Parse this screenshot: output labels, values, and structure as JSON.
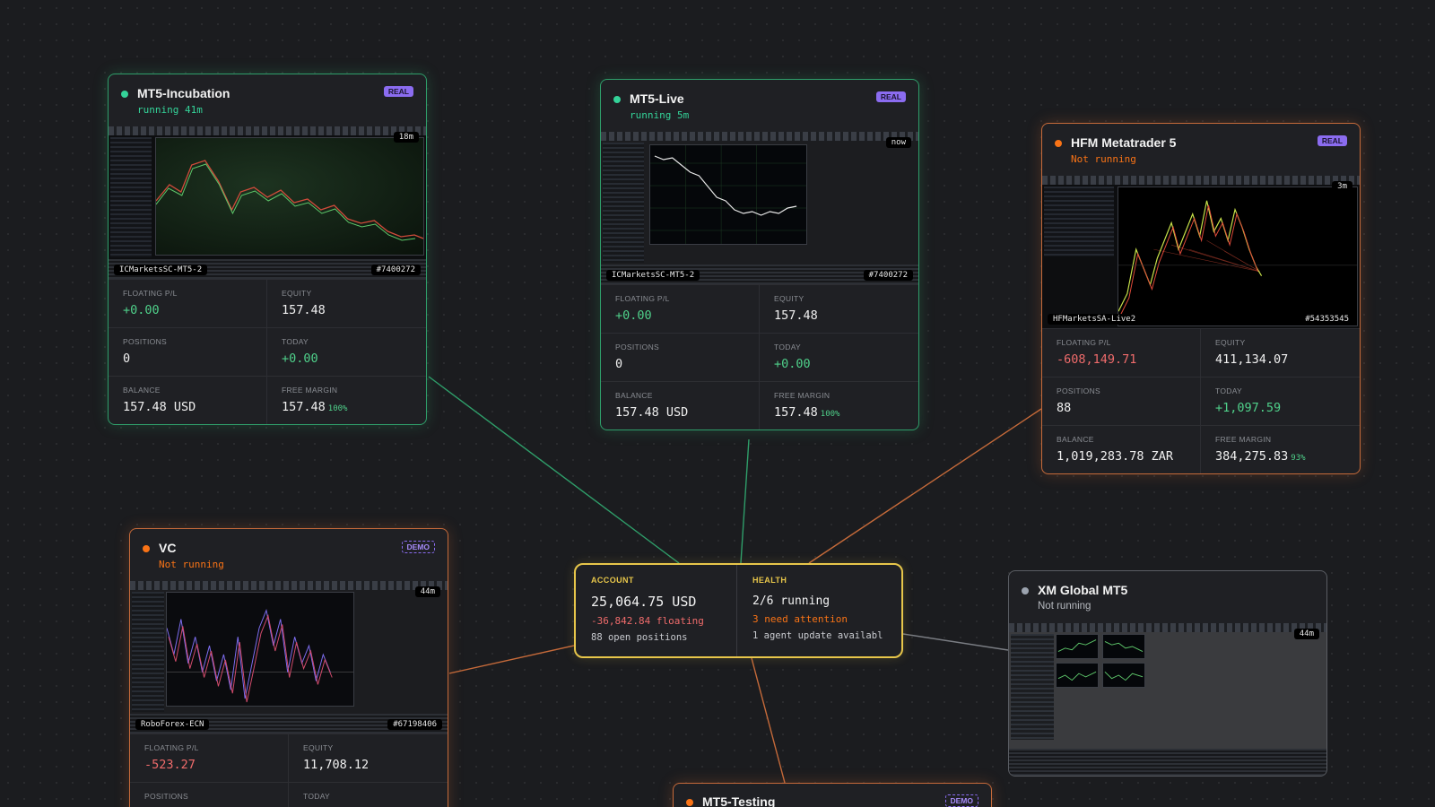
{
  "colors": {
    "running": "#34d399",
    "not_running": "#f97316",
    "offline": "#9ca3af",
    "positive": "#4fd08a",
    "negative": "#ef6b6b",
    "badge": "#8b6cf0",
    "summary_accent": "#e7c64a"
  },
  "labels": {
    "floating": "FLOATING P/L",
    "equity": "EQUITY",
    "positions": "POSITIONS",
    "today": "TODAY",
    "balance": "BALANCE",
    "free_margin": "FREE MARGIN"
  },
  "terminals": [
    {
      "name": "MT5-Incubation",
      "status": "running 41m",
      "badge": "REAL",
      "age": "18m",
      "server": "ICMarketsSC-MT5-2",
      "account": "#7400272",
      "floating": "+0.00",
      "equity": "157.48",
      "positions": "0",
      "today": "+0.00",
      "balance": "157.48 USD",
      "free_margin": "157.48",
      "free_margin_pct": "100%"
    },
    {
      "name": "MT5-Live",
      "status": "running 5m",
      "badge": "REAL",
      "age": "now",
      "server": "ICMarketsSC-MT5-2",
      "account": "#7400272",
      "floating": "+0.00",
      "equity": "157.48",
      "positions": "0",
      "today": "+0.00",
      "balance": "157.48 USD",
      "free_margin": "157.48",
      "free_margin_pct": "100%"
    },
    {
      "name": "HFM Metatrader 5",
      "status": "Not running",
      "badge": "REAL",
      "age": "3m",
      "server": "HFMarketsSA-Live2",
      "account": "#54353545",
      "floating": "-608,149.71",
      "equity": "411,134.07",
      "positions": "88",
      "today": "+1,097.59",
      "balance": "1,019,283.78 ZAR",
      "free_margin": "384,275.83",
      "free_margin_pct": "93%"
    },
    {
      "name": "VC",
      "status": "Not running",
      "badge": "DEMO",
      "age": "44m",
      "server": "RoboForex-ECN",
      "account": "#67198406",
      "floating": "-523.27",
      "equity": "11,708.12"
    },
    {
      "name": "XM Global MT5",
      "status": "Not running",
      "age": "44m"
    },
    {
      "name": "MT5-Testing",
      "badge": "DEMO"
    }
  ],
  "summary": {
    "account_label": "ACCOUNT",
    "total": "25,064.75 USD",
    "floating": "-36,842.84 floating",
    "open_positions": "88 open positions",
    "health_label": "HEALTH",
    "running": "2/6 running",
    "attention": "3 need attention",
    "update": "1 agent update availabl"
  }
}
